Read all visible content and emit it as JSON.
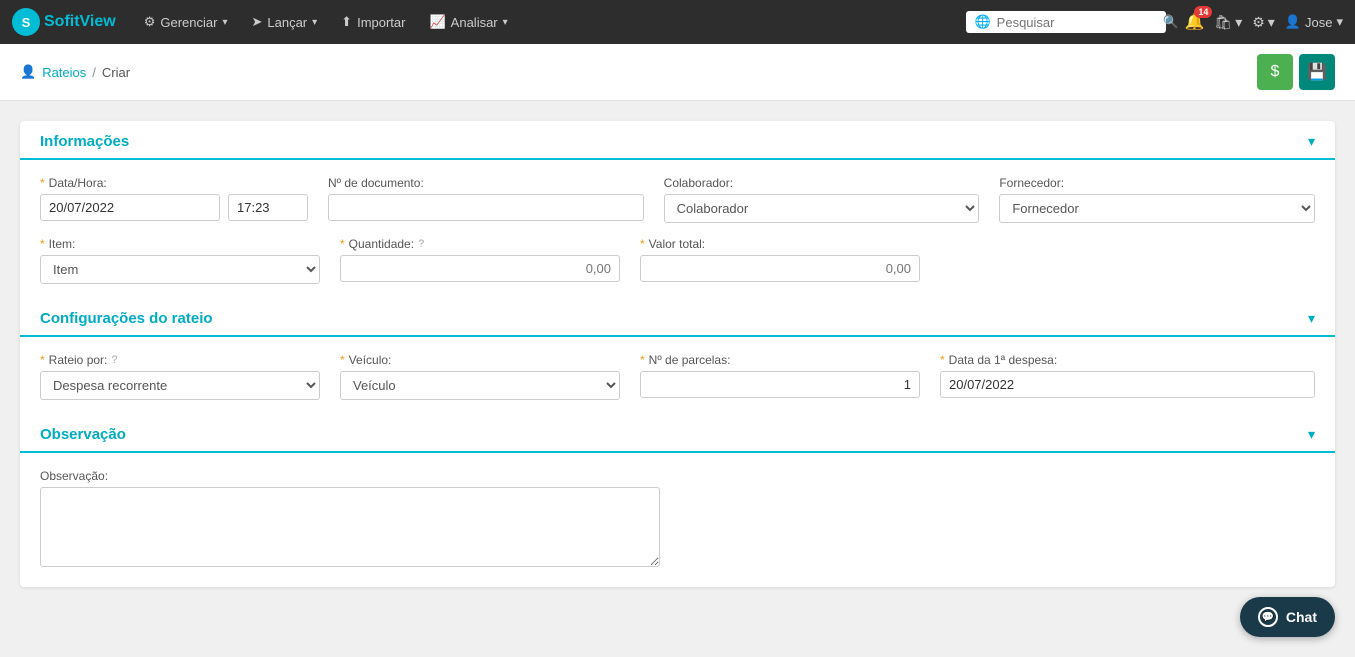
{
  "brand": {
    "icon_text": "S",
    "name_part1": "Sofit",
    "name_part2": "View"
  },
  "navbar": {
    "gerenciar_label": "Gerenciar",
    "lancar_label": "Lançar",
    "importar_label": "Importar",
    "analisar_label": "Analisar",
    "search_placeholder": "Pesquisar",
    "notifications_badge": "14",
    "settings_label": "",
    "user_label": "Jose"
  },
  "breadcrumb": {
    "link_label": "Rateios",
    "separator": "/",
    "current": "Criar"
  },
  "sections": {
    "informacoes": {
      "title": "Informações",
      "fields": {
        "data_hora_label": "Data/Hora:",
        "data_value": "20/07/2022",
        "hora_value": "17:23",
        "nr_documento_label": "Nº de documento:",
        "colaborador_label": "Colaborador:",
        "colaborador_placeholder": "Colaborador",
        "fornecedor_label": "Fornecedor:",
        "fornecedor_placeholder": "Fornecedor",
        "item_label": "Item:",
        "item_placeholder": "Item",
        "quantidade_label": "Quantidade:",
        "quantidade_placeholder": "0,00",
        "valor_total_label": "Valor total:",
        "valor_total_placeholder": "0,00"
      }
    },
    "configuracoes": {
      "title": "Configurações do rateio",
      "fields": {
        "rateio_por_label": "Rateio por:",
        "rateio_por_value": "Despesa recorrente",
        "veiculo_label": "Veículo:",
        "veiculo_placeholder": "Veículo",
        "nr_parcelas_label": "Nº de parcelas:",
        "nr_parcelas_value": "1",
        "data_primeira_label": "Data da 1ª despesa:",
        "data_primeira_value": "20/07/2022"
      }
    },
    "observacao": {
      "title": "Observação",
      "fields": {
        "observacao_label": "Observação:",
        "observacao_placeholder": ""
      }
    }
  },
  "chat": {
    "label": "Chat"
  }
}
